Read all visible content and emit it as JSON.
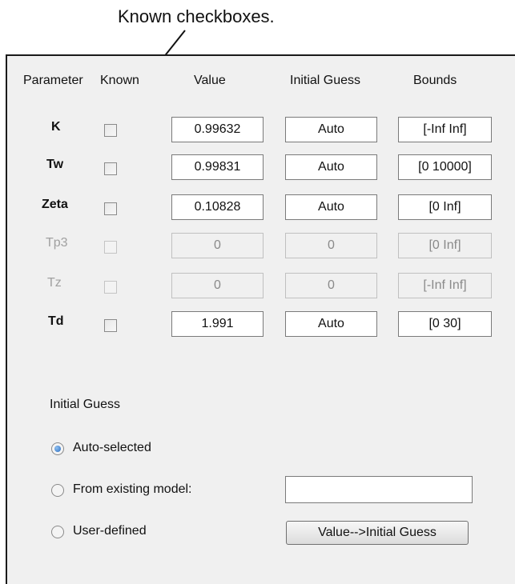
{
  "annotation": {
    "callout_text": "Known checkboxes."
  },
  "table": {
    "headers": {
      "parameter": "Parameter",
      "known": "Known",
      "value": "Value",
      "initial_guess": "Initial Guess",
      "bounds": "Bounds"
    },
    "rows": [
      {
        "name": "K",
        "known_checked": false,
        "enabled": true,
        "value": "0.99632",
        "initial_guess": "Auto",
        "bounds": "[-Inf Inf]"
      },
      {
        "name": "Tw",
        "known_checked": false,
        "enabled": true,
        "value": "0.99831",
        "initial_guess": "Auto",
        "bounds": "[0 10000]"
      },
      {
        "name": "Zeta",
        "known_checked": false,
        "enabled": true,
        "value": "0.10828",
        "initial_guess": "Auto",
        "bounds": "[0 Inf]"
      },
      {
        "name": "Tp3",
        "known_checked": false,
        "enabled": false,
        "value": "0",
        "initial_guess": "0",
        "bounds": "[0 Inf]"
      },
      {
        "name": "Tz",
        "known_checked": false,
        "enabled": false,
        "value": "0",
        "initial_guess": "0",
        "bounds": "[-Inf Inf]"
      },
      {
        "name": "Td",
        "known_checked": false,
        "enabled": true,
        "value": "1.991",
        "initial_guess": "Auto",
        "bounds": "[0 30]"
      }
    ]
  },
  "initial_guess_section": {
    "label": "Initial Guess",
    "options": [
      {
        "label": "Auto-selected",
        "selected": true
      },
      {
        "label": "From existing model:",
        "selected": false
      },
      {
        "label": "User-defined",
        "selected": false
      }
    ],
    "existing_model_value": "",
    "value_to_guess_button": "Value-->Initial Guess"
  },
  "colors": {
    "panel_bg": "#f0f0f0",
    "disabled_text": "#a0a0a0",
    "radio_selected": "#2a6cc0"
  }
}
